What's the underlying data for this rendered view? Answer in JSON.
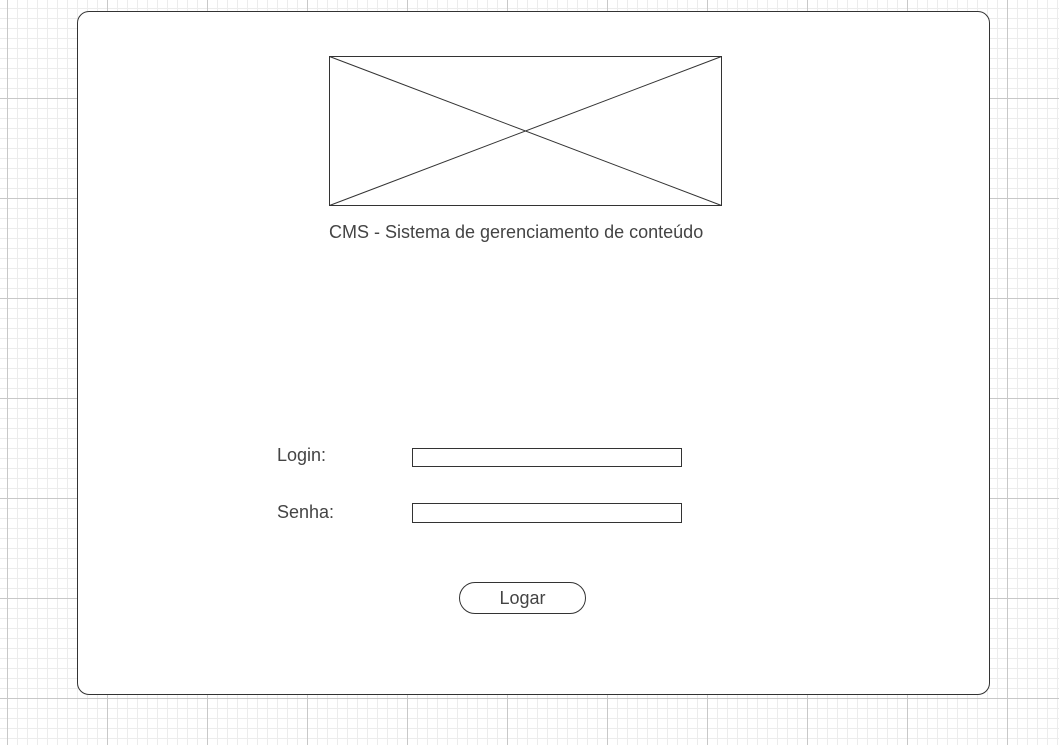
{
  "app": {
    "title": "CMS - Sistema de gerenciamento de conteúdo"
  },
  "logo": {
    "type": "image-placeholder"
  },
  "form": {
    "login_label": "Login:",
    "login_value": "",
    "senha_label": "Senha:",
    "senha_value": "",
    "submit_label": "Logar"
  },
  "colors": {
    "border": "#333333",
    "text": "#444444",
    "grid_major": "#c8c8c8",
    "grid_minor": "#ececec",
    "background": "#ffffff"
  }
}
